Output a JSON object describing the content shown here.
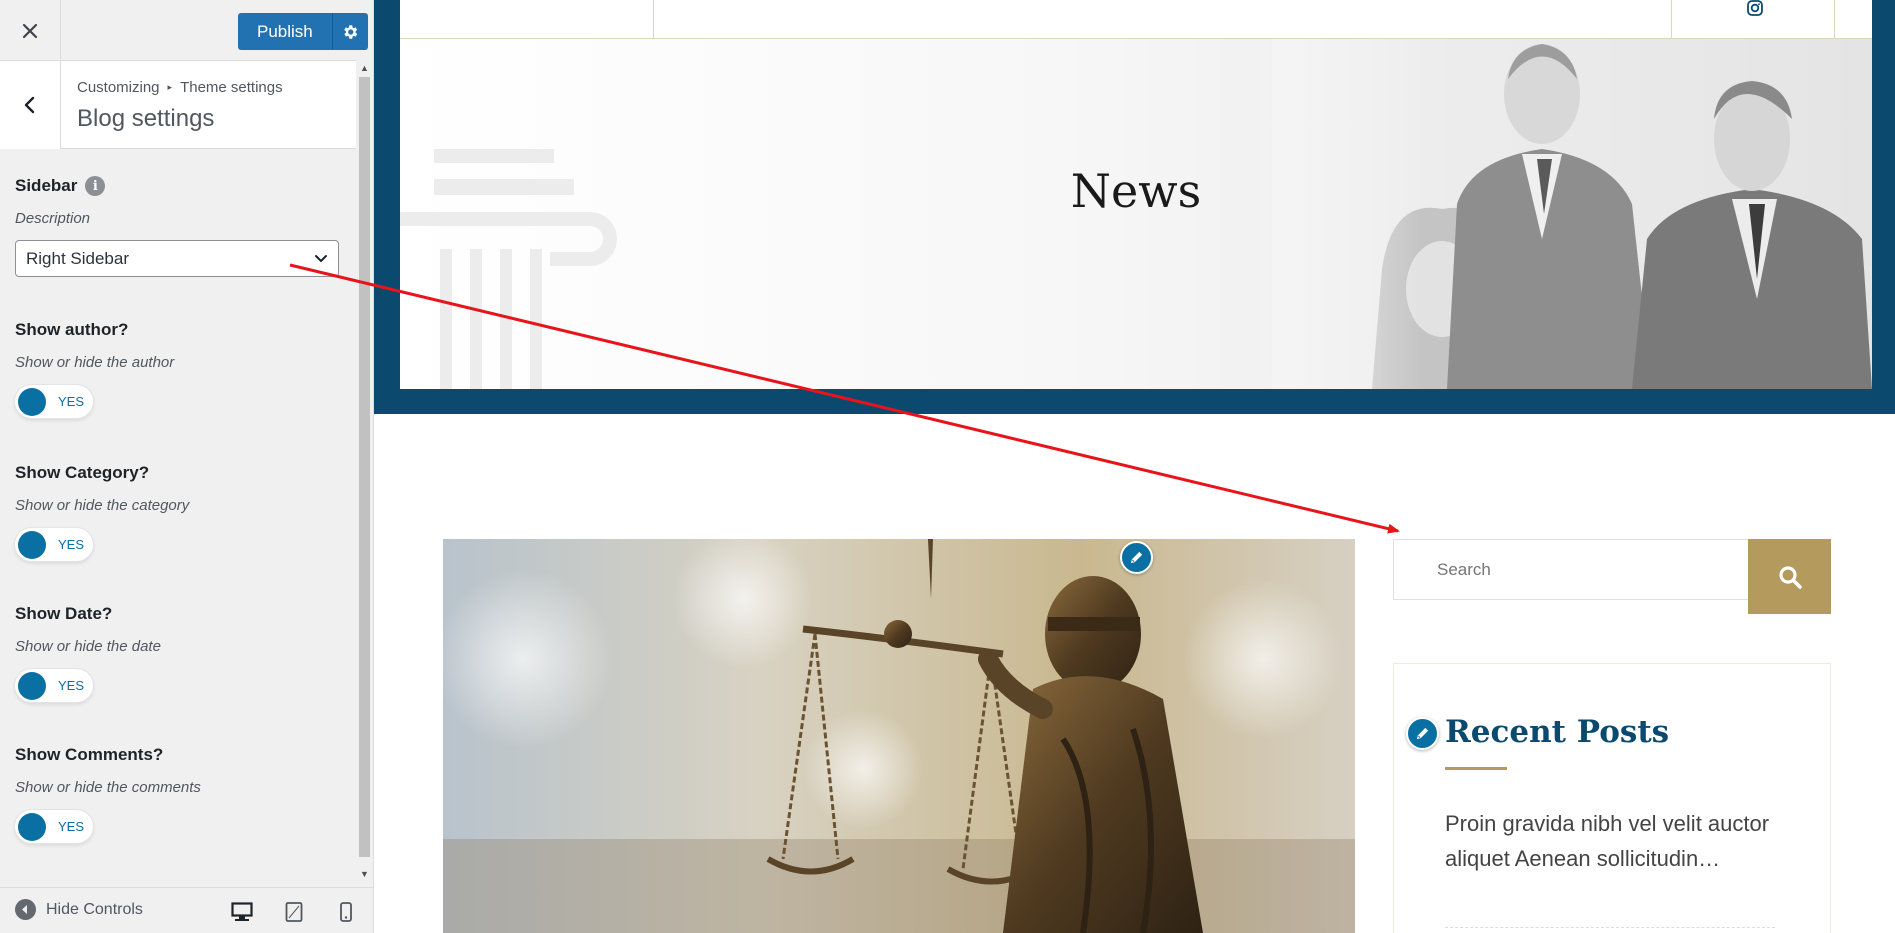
{
  "customizer": {
    "publish_label": "Publish",
    "breadcrumb": {
      "root": "Customizing",
      "separator": "▸",
      "parent": "Theme settings"
    },
    "section_title": "Blog settings",
    "sidebar_control": {
      "label": "Sidebar",
      "description": "Description",
      "selected_value": "Right Sidebar"
    },
    "toggles": [
      {
        "label": "Show author?",
        "description": "Show or hide the author",
        "state": "YES"
      },
      {
        "label": "Show Category?",
        "description": "Show or hide the category",
        "state": "YES"
      },
      {
        "label": "Show Date?",
        "description": "Show or hide the date",
        "state": "YES"
      },
      {
        "label": "Show Comments?",
        "description": "Show or hide the comments",
        "state": "YES"
      }
    ],
    "footer": {
      "hide_controls_label": "Hide Controls"
    },
    "icons": [
      "close-icon",
      "gear-icon",
      "chevron-left-icon",
      "info-icon",
      "chevron-down-icon",
      "hide-controls-icon",
      "desktop-icon",
      "tablet-icon",
      "mobile-icon"
    ]
  },
  "preview": {
    "hero_title": "News",
    "search": {
      "placeholder": "Search"
    },
    "recent_posts": {
      "title": "Recent Posts",
      "items": [
        "Proin gravida nibh vel velit auctor aliquet Aenean sollicitudin…"
      ]
    },
    "icons": [
      "instagram-icon",
      "search-icon",
      "pencil-edit-icon"
    ]
  },
  "colors": {
    "wp_blue": "#2271b1",
    "toggle_blue": "#0a6fa3",
    "site_navy": "#0b4a6e",
    "site_gold": "#b49a5c",
    "annotation_red": "#e8141b"
  }
}
